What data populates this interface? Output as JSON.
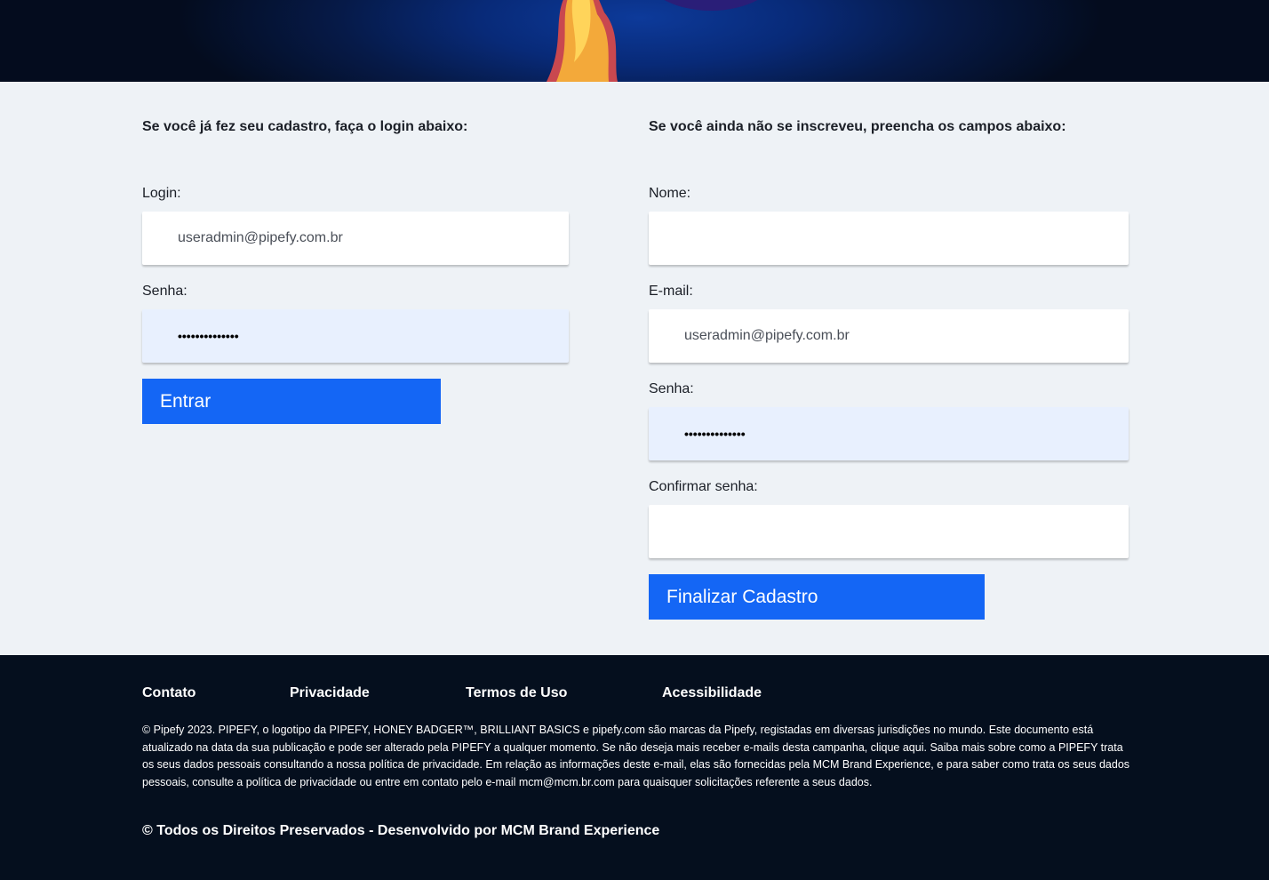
{
  "login": {
    "intro": "Se você já fez seu cadastro, faça o login abaixo:",
    "login_label": "Login:",
    "login_value": "useradmin@pipefy.com.br",
    "password_label": "Senha:",
    "password_value": "••••••••••••••",
    "submit_label": "Entrar"
  },
  "signup": {
    "intro": "Se você ainda não se inscreveu, preencha os campos abaixo:",
    "name_label": "Nome:",
    "name_value": "",
    "email_label": "E-mail:",
    "email_value": "useradmin@pipefy.com.br",
    "password_label": "Senha:",
    "password_value": "••••••••••••••",
    "confirm_label": "Confirmar senha:",
    "confirm_value": "",
    "submit_label": "Finalizar Cadastro"
  },
  "footer": {
    "links": {
      "contact": "Contato",
      "privacy": "Privacidade",
      "terms": "Termos de Uso",
      "accessibility": "Acessibilidade"
    },
    "legal": "© Pipefy 2023. PIPEFY, o logotipo da PIPEFY, HONEY BADGER™, BRILLIANT BASICS e pipefy.com são marcas da Pipefy, registadas em diversas jurisdições no mundo. Este documento está atualizado na data da sua publicação e pode ser alterado pela PIPEFY a qualquer momento. Se não deseja mais receber e-mails desta campanha, clique aqui. Saiba mais sobre como a PIPEFY trata os seus dados pessoais consultando a nossa política de privacidade. Em relação as informações deste e-mail, elas são fornecidas pela MCM Brand Experience, e para saber como trata os seus dados pessoais, consulte a política de privacidade ou entre em contato pelo e-mail mcm@mcm.br.com para quaisquer solicitações referente a seus dados.",
    "rights": "© Todos os Direitos Preservados - Desenvolvido por MCM Brand Experience"
  },
  "colors": {
    "accent": "#1466f5",
    "page_bg": "#eef2f6",
    "footer_bg": "#050f1e",
    "autofill_bg": "#e8f0fe"
  },
  "icons": {
    "hero": "rocket-flame-illustration"
  }
}
